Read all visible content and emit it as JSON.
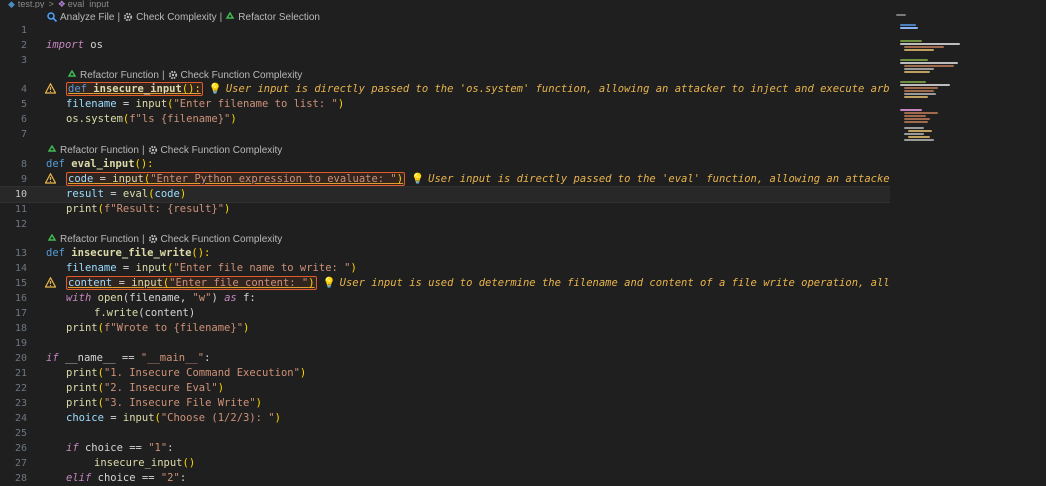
{
  "breadcrumb": {
    "file": "test.py",
    "symbol": "eval_input",
    "separator": ">"
  },
  "toolbar": {
    "analyze": "Analyze File",
    "complexity": "Check Complexity",
    "refactor": "Refactor Selection",
    "sep": "|"
  },
  "lens": {
    "refactor": "Refactor Function",
    "complexity": "Check Function Complexity",
    "sep": "|"
  },
  "warnings": {
    "w4": "User input is directly passed to the 'os.system' function, allowing an attacker to inject and execute arbitrar",
    "w9": "User input is directly passed to the 'eval' function, allowing an attacker",
    "w15": "User input is used to determine the filename and content of a file write operation, allo"
  },
  "lines": {
    "l2": [
      "import",
      " os"
    ],
    "l4": [
      "def",
      " ",
      "insecure_input",
      "():"
    ],
    "l5": [
      "filename",
      " = ",
      "input",
      "(",
      "\"Enter filename to list: \"",
      ")"
    ],
    "l6": [
      "os.system",
      "(",
      "f\"ls {filename}\"",
      ")"
    ],
    "l8": [
      "def",
      " ",
      "eval_input",
      "():"
    ],
    "l9": [
      "code",
      " = ",
      "input",
      "(",
      "\"Enter Python expression to evaluate: \"",
      ")"
    ],
    "l10": [
      "result",
      " = ",
      "eval",
      "(",
      "code",
      ")"
    ],
    "l11": [
      "print",
      "(",
      "f\"Result: {result}\"",
      ")"
    ],
    "l13": [
      "def",
      " ",
      "insecure_file_write",
      "():"
    ],
    "l14": [
      "filename",
      " = ",
      "input",
      "(",
      "\"Enter file name to write: \"",
      ")"
    ],
    "l15": [
      "content",
      " = ",
      "input",
      "(",
      "\"Enter file content: \"",
      ")"
    ],
    "l16": [
      "with",
      " ",
      "open",
      "(filename, ",
      "\"w\"",
      ") ",
      "as",
      " f:"
    ],
    "l17": [
      "f.write",
      "(content)"
    ],
    "l18": [
      "print",
      "(",
      "f\"Wrote to {filename}\"",
      ")"
    ],
    "l20": [
      "if",
      " __name__ == ",
      "\"__main__\"",
      ":"
    ],
    "l21": [
      "print",
      "(",
      "\"1. Insecure Command Execution\"",
      ")"
    ],
    "l22": [
      "print",
      "(",
      "\"2. Insecure Eval\"",
      ")"
    ],
    "l23": [
      "print",
      "(",
      "\"3. Insecure File Write\"",
      ")"
    ],
    "l24": [
      "choice",
      " = ",
      "input",
      "(",
      "\"Choose (1/2/3): \"",
      ")"
    ],
    "l26": [
      "if",
      " choice == ",
      "\"1\"",
      ":"
    ],
    "l27": [
      "insecure_input",
      "()"
    ],
    "l28": [
      "elif",
      " choice == ",
      "\"2\"",
      ":"
    ]
  },
  "line_numbers": [
    "1",
    "2",
    "3",
    "4",
    "5",
    "6",
    "7",
    "8",
    "9",
    "10",
    "11",
    "12",
    "13",
    "14",
    "15",
    "16",
    "17",
    "18",
    "19",
    "20",
    "21",
    "22",
    "23",
    "24",
    "25",
    "26",
    "27",
    "28"
  ],
  "colors": {
    "background": "#1f1f1f",
    "warning": "#e9b44c",
    "highlight_border": "#e05a2b",
    "keyword": "#569cd6",
    "function": "#dcdcaa",
    "string": "#ce9178"
  }
}
